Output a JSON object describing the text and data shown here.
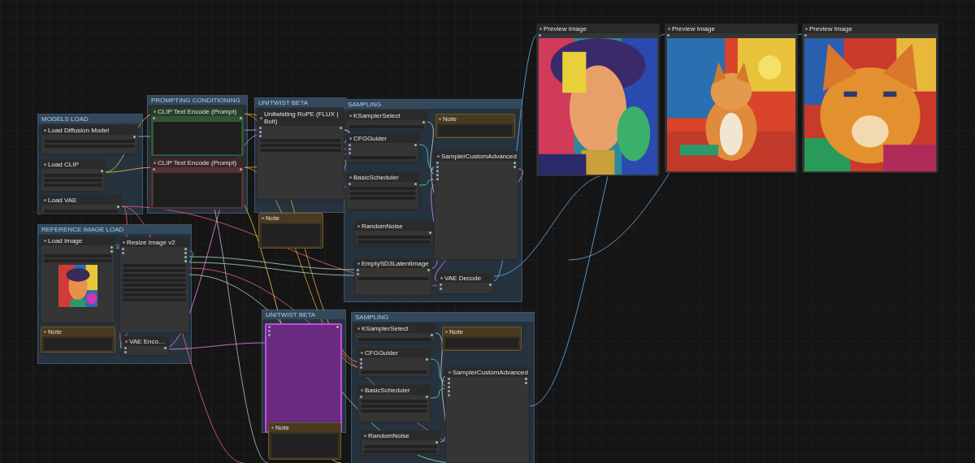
{
  "groups": [
    {
      "title": "MODELS LOAD"
    },
    {
      "title": "PROMPTING CONDITIONING"
    },
    {
      "title": "UNITWIST BETA"
    },
    {
      "title": "SAMPLING"
    },
    {
      "title": "REFERENCE IMAGE LOAD"
    },
    {
      "title": "UNITWIST BETA"
    },
    {
      "title": "SAMPLING"
    }
  ],
  "nodes": [
    {
      "kind": "node",
      "title": "Load Diffusion Model"
    },
    {
      "kind": "node",
      "title": "Load CLIP"
    },
    {
      "kind": "node",
      "title": "Load VAE"
    },
    {
      "kind": "node",
      "title": "CLIP Text Encode (Prompt)",
      "color": "#335533"
    },
    {
      "kind": "node",
      "title": "CLIP Text Encode (Prompt)",
      "color": "#553333"
    },
    {
      "kind": "node",
      "title": "Unitwisting RoPE (FLUX | Bolt)"
    },
    {
      "kind": "note",
      "title": "Note"
    },
    {
      "kind": "node",
      "title": "KSamplerSelect"
    },
    {
      "kind": "node",
      "title": "CFGGuider"
    },
    {
      "kind": "node",
      "title": "BasicScheduler"
    },
    {
      "kind": "node",
      "title": "RandomNoise"
    },
    {
      "kind": "node",
      "title": "EmptySD3LatentImage"
    },
    {
      "kind": "note",
      "title": "Note"
    },
    {
      "kind": "node",
      "title": "SamplerCustomAdvanced"
    },
    {
      "kind": "node",
      "title": "VAE Decode"
    },
    {
      "kind": "node",
      "title": "Load Image"
    },
    {
      "kind": "node",
      "title": "Resize Image v2"
    },
    {
      "kind": "note",
      "title": "Note"
    },
    {
      "kind": "node",
      "title": "VAE Enco…"
    },
    {
      "kind": "node",
      "color": "#6a2a80",
      "bypassed": true
    },
    {
      "kind": "note",
      "title": "Note"
    },
    {
      "kind": "node",
      "title": "KSamplerSelect"
    },
    {
      "kind": "node",
      "title": "CFGGuider"
    },
    {
      "kind": "node",
      "title": "BasicScheduler"
    },
    {
      "kind": "node",
      "title": "RandomNoise"
    },
    {
      "kind": "note",
      "title": "Note"
    },
    {
      "kind": "node",
      "title": "SamplerCustomAdvanced"
    },
    {
      "kind": "preview",
      "title": "Preview Image"
    },
    {
      "kind": "preview",
      "title": "Preview Image"
    },
    {
      "kind": "preview",
      "title": "Preview Image"
    }
  ]
}
